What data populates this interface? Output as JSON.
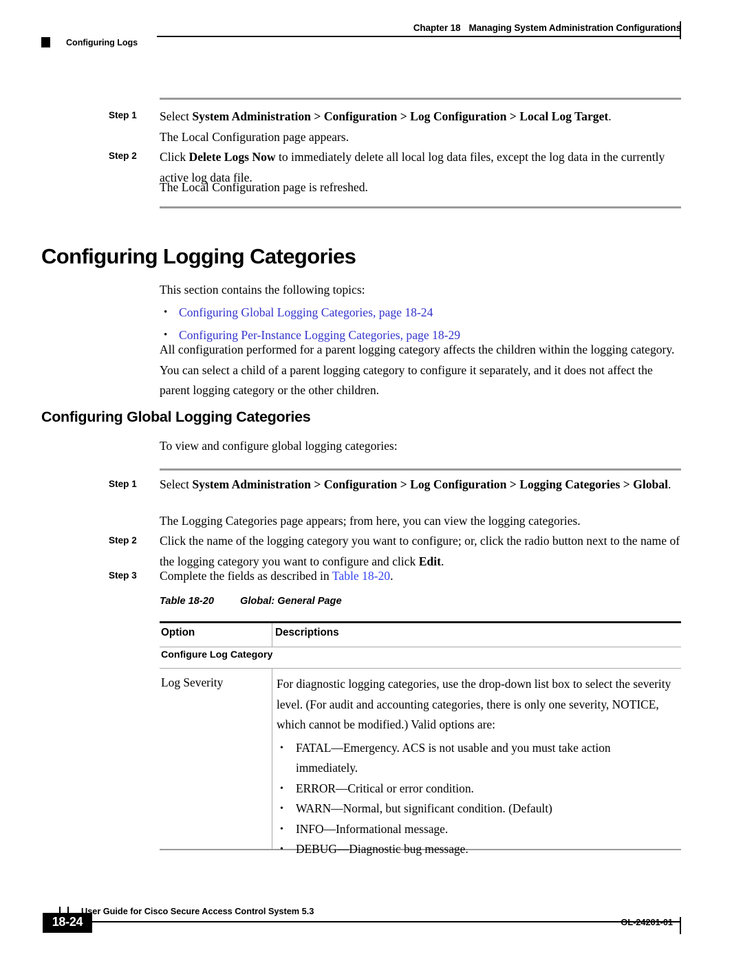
{
  "header": {
    "chapter_number": "Chapter 18",
    "chapter_title": "Managing System Administration Configurations",
    "section_label": "Configuring Logs"
  },
  "top_steps": [
    {
      "label": "Step 1",
      "lead": "Select ",
      "bold": "System Administration > Configuration > Log Configuration > Local Log Target",
      "tail": ".",
      "result": "The Local Configuration page appears."
    },
    {
      "label": "Step 2",
      "lead": "Click ",
      "bold": "Delete Logs Now",
      "tail": " to immediately delete all local log data files, except the log data in the currently active log data file.",
      "result": "The Local Configuration page is refreshed."
    }
  ],
  "section": {
    "heading": "Configuring Logging Categories",
    "intro": "This section contains the following topics:",
    "xrefs": [
      "Configuring Global Logging Categories, page 18-24",
      "Configuring Per-Instance Logging Categories, page 18-29"
    ],
    "paragraph": "All configuration performed for a parent logging category affects the children within the logging category. You can select a child of a parent logging category to configure it separately, and it does not affect the parent logging category or the other children."
  },
  "subsection": {
    "heading": "Configuring Global Logging Categories",
    "intro": "To view and configure global logging categories:",
    "steps": [
      {
        "label": "Step 1",
        "lead": "Select ",
        "bold": "System Administration > Configuration > Log Configuration > Logging Categories > Global",
        "tail": ".",
        "result": "The Logging Categories page appears; from here, you can view the logging categories."
      },
      {
        "label": "Step 2",
        "lead": "Click the name of the logging category you want to configure; or, click the radio button next to the name of the logging category you want to configure and click ",
        "bold": "Edit",
        "tail": "."
      },
      {
        "label": "Step 3",
        "lead": "Complete the fields as described in ",
        "link": "Table 18-20",
        "tail": "."
      }
    ]
  },
  "table": {
    "caption_number": "Table 18-20",
    "caption_title": "Global: General Page",
    "columns": [
      "Option",
      "Descriptions"
    ],
    "subhead": "Configure Log Category",
    "rows": [
      {
        "option": "Log Severity",
        "description": "For diagnostic logging categories, use the drop-down list box to select the severity level. (For audit and accounting categories, there is only one severity, NOTICE, which cannot be modified.) Valid options are:",
        "bullets": [
          "FATAL—Emergency. ACS is not usable and you must take action immediately.",
          "ERROR—Critical or error condition.",
          "WARN—Normal, but significant condition. (Default)",
          "INFO—Informational message.",
          "DEBUG—Diagnostic bug message."
        ]
      }
    ]
  },
  "footer": {
    "guide_title": "User Guide for Cisco Secure Access Control System 5.3",
    "page_number": "18-24",
    "doc_number": "OL-24201-01"
  },
  "colors": {
    "xref": "#3333cc",
    "xref_bright": "#3344ee",
    "rule_gray": "#9a9a9a",
    "rule_dark": "#1a1a1a"
  }
}
